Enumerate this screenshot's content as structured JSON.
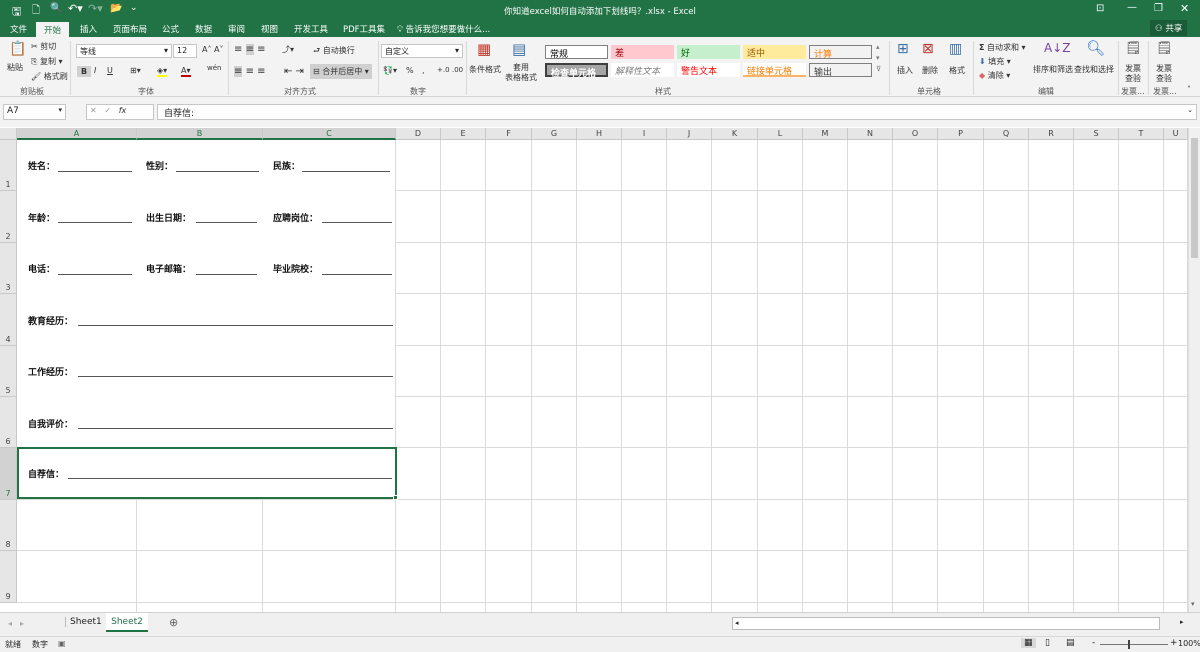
{
  "title_bar": {
    "title": "你知道excel如何自动添加下划线吗？.xlsx - Excel",
    "quick_access": [
      "save-icon",
      "new-file-icon",
      "print-preview-icon",
      "undo-icon",
      "redo-icon",
      "open-folder-icon"
    ],
    "share_label": "共享"
  },
  "tabs": [
    "文件",
    "开始",
    "插入",
    "页面布局",
    "公式",
    "数据",
    "审阅",
    "视图",
    "开发工具",
    "PDF工具集"
  ],
  "active_tab": "开始",
  "tell_me": "告诉我您想要做什么...",
  "ribbon": {
    "clipboard": {
      "paste": "粘贴",
      "cut": "剪切",
      "copy": "复制",
      "format_painter": "格式刷",
      "group": "剪贴板"
    },
    "font": {
      "name": "等线",
      "size": "12",
      "bold": "B",
      "italic": "I",
      "underline": "U",
      "group": "字体",
      "phonetic": "wén"
    },
    "alignment": {
      "wrap": "自动换行",
      "merge": "合并后居中",
      "group": "对齐方式"
    },
    "number": {
      "format": "自定义",
      "percent": "%",
      "comma": ",",
      "inc": "+.0",
      "dec": ".00",
      "group": "数字"
    },
    "styles": {
      "conditional": "条件格式",
      "table": "套用\n表格格式",
      "group": "样式",
      "cells": [
        {
          "label": "常规",
          "bg": "#ffffff",
          "color": "#000000"
        },
        {
          "label": "差",
          "bg": "#ffc7ce",
          "color": "#9c0006"
        },
        {
          "label": "好",
          "bg": "#c6efce",
          "color": "#006100"
        },
        {
          "label": "适中",
          "bg": "#ffeb9c",
          "color": "#9c5700"
        },
        {
          "label": "计算",
          "bg": "#f2f2f2",
          "color": "#fa7d00"
        },
        {
          "label": "检查单元格",
          "bg": "#a5a5a5",
          "color": "#ffffff"
        },
        {
          "label": "解释性文本",
          "bg": "#ffffff",
          "color": "#7f7f7f"
        },
        {
          "label": "警告文本",
          "bg": "#ffffff",
          "color": "#ff0000"
        },
        {
          "label": "链接单元格",
          "bg": "#ffffff",
          "color": "#fa7d00"
        },
        {
          "label": "输出",
          "bg": "#f2f2f2",
          "color": "#3f3f3f"
        }
      ]
    },
    "cells": {
      "insert": "插入",
      "delete": "删除",
      "format": "格式",
      "group": "单元格"
    },
    "editing": {
      "autosum": "自动求和",
      "fill": "填充",
      "clear": "清除",
      "sort": "排序和筛选",
      "find": "查找和选择",
      "group": "编辑"
    },
    "invoice1": {
      "label": "发票\n查验",
      "group": "发票..."
    },
    "invoice2": {
      "label": "发票\n查验",
      "group": "发票..."
    }
  },
  "formula_bar": {
    "name_box": "A7",
    "fx": "fx",
    "value": "自荐信:"
  },
  "columns": [
    "A",
    "B",
    "C",
    "D",
    "E",
    "F",
    "G",
    "H",
    "I",
    "J",
    "K",
    "L",
    "M",
    "N",
    "O",
    "P",
    "Q",
    "R",
    "S",
    "T",
    "U"
  ],
  "rows": [
    "1",
    "2",
    "3",
    "4",
    "5",
    "6",
    "7",
    "8",
    "9"
  ],
  "cells": {
    "r1": [
      "姓名：",
      "性别：",
      "民族："
    ],
    "r2": [
      "年龄：",
      "出生日期：",
      "应聘岗位："
    ],
    "r3": [
      "电话：",
      "电子邮箱：",
      "毕业院校："
    ],
    "r4": "教育经历：",
    "r5": "工作经历：",
    "r6": "自我评价：",
    "r7": "自荐信："
  },
  "selected_cell": "A7",
  "sheets": [
    "Sheet1",
    "Sheet2"
  ],
  "active_sheet": "Sheet2",
  "status": {
    "ready": "就绪",
    "num": "数字",
    "zoom": "100%"
  },
  "colors": {
    "accent": "#217346"
  }
}
